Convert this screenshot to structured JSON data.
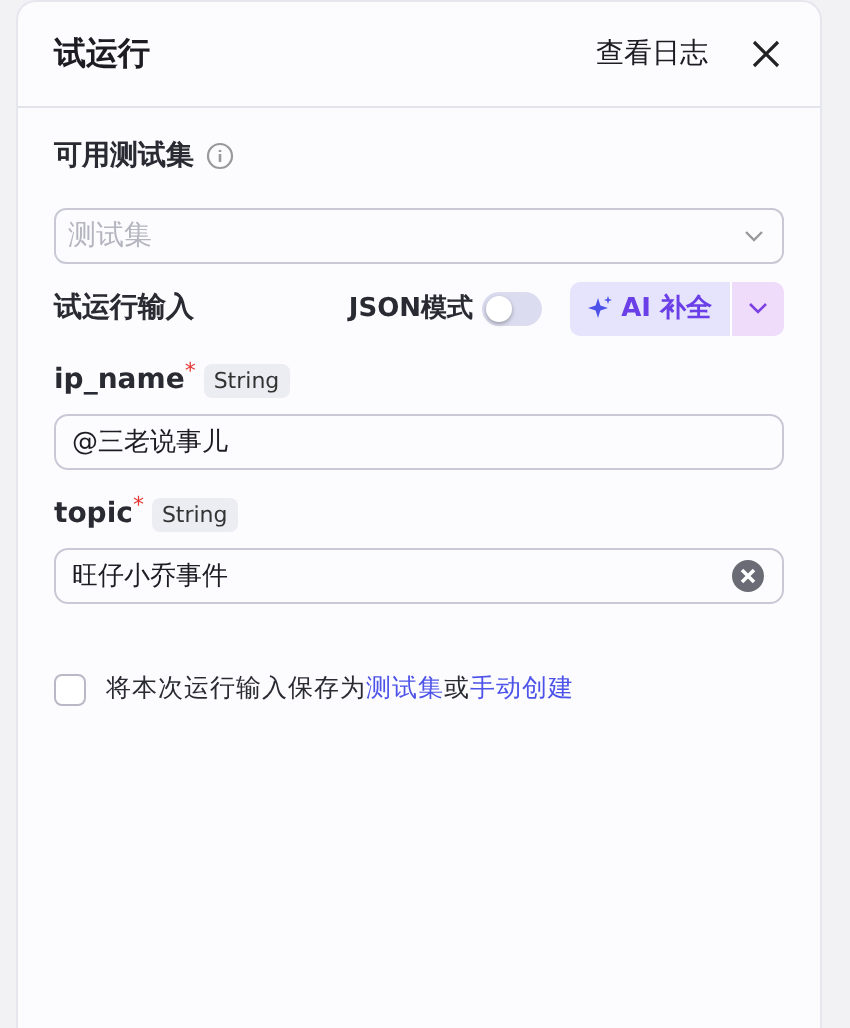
{
  "header": {
    "title": "试运行",
    "log_link": "查看日志"
  },
  "test_set": {
    "label": "可用测试集",
    "placeholder": "测试集"
  },
  "run_input": {
    "label": "试运行输入",
    "json_mode_label": "JSON模式",
    "json_mode": false,
    "ai_button": "AI 补全"
  },
  "fields": [
    {
      "name": "ip_name",
      "required_mark": "*",
      "type": "String",
      "value": "@三老说事儿",
      "clearable": false
    },
    {
      "name": "topic",
      "required_mark": "*",
      "type": "String",
      "value": "旺仔小乔事件",
      "clearable": true
    }
  ],
  "save_option": {
    "checked": false,
    "parts": [
      {
        "kind": "text",
        "text": "将本次运行输入保存为"
      },
      {
        "kind": "link",
        "text": "测试集"
      },
      {
        "kind": "text",
        "text": "或"
      },
      {
        "kind": "link",
        "text": "手动创建"
      }
    ]
  }
}
